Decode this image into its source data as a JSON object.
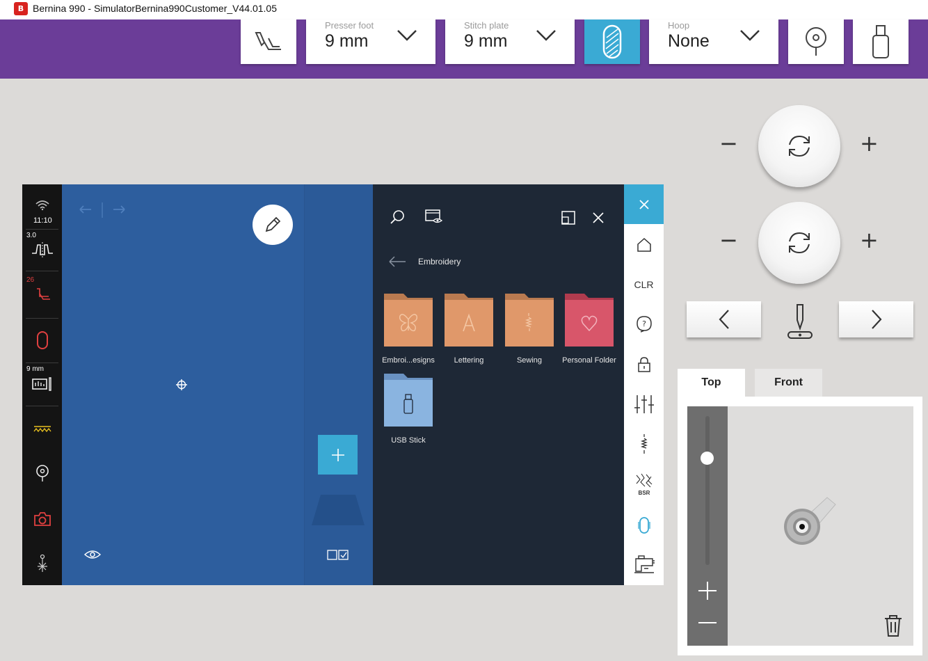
{
  "window": {
    "title": "Bernina 990 - SimulatorBernina990Customer_V44.01.05",
    "app_icon": "bernina-logo-icon"
  },
  "toolbar": {
    "presser_foot": {
      "caption": "Presser foot",
      "value": "9 mm"
    },
    "stitch_plate": {
      "caption": "Stitch plate",
      "value": "9 mm"
    },
    "hoop": {
      "caption": "Hoop",
      "value": "None"
    }
  },
  "status": {
    "time": "11:10",
    "tension": "3.0",
    "foot_number": "26",
    "plate": "9 mm"
  },
  "browser": {
    "breadcrumb": "Embroidery",
    "folders": [
      {
        "label": "Embroi...esigns",
        "icon": "butterfly-icon",
        "color": "#e0986a"
      },
      {
        "label": "Lettering",
        "icon": "letter-a-icon",
        "color": "#e0986a"
      },
      {
        "label": "Sewing",
        "icon": "stitch-icon",
        "color": "#e0986a"
      },
      {
        "label": "Personal Folder",
        "icon": "heart-icon",
        "color": "#d8566a"
      },
      {
        "label": "USB Stick",
        "icon": "usb-stick-icon",
        "color": "#8ab4e0"
      }
    ]
  },
  "rightbar": {
    "clr": "CLR",
    "bsr": "BSR"
  },
  "view_tabs": {
    "top": "Top",
    "front": "Front"
  },
  "colors": {
    "accent": "#3aaad4",
    "purple": "#6b3d98",
    "canvas": "#2d5e9e",
    "panel": "#1e2836"
  }
}
